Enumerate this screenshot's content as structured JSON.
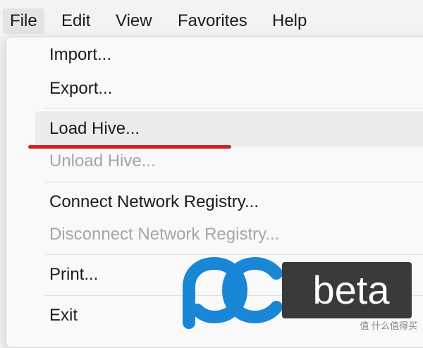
{
  "menubar": {
    "items": [
      {
        "label": "File"
      },
      {
        "label": "Edit"
      },
      {
        "label": "View"
      },
      {
        "label": "Favorites"
      },
      {
        "label": "Help"
      }
    ]
  },
  "file_menu": {
    "items": [
      {
        "label": "Import...",
        "enabled": true
      },
      {
        "label": "Export...",
        "enabled": true
      },
      {
        "label": "Load Hive...",
        "enabled": true,
        "hovered": true,
        "annotated": true
      },
      {
        "label": "Unload Hive...",
        "enabled": false
      },
      {
        "label": "Connect Network Registry...",
        "enabled": true
      },
      {
        "label": "Disconnect Network Registry...",
        "enabled": false
      },
      {
        "label": "Print...",
        "enabled": true
      },
      {
        "label": "Exit",
        "enabled": true
      }
    ]
  },
  "overlay": {
    "annotation_color": "#d42020",
    "logo_text": "beta",
    "logo_blue": "#1a87d6",
    "watermark": "值 什么值得买"
  }
}
